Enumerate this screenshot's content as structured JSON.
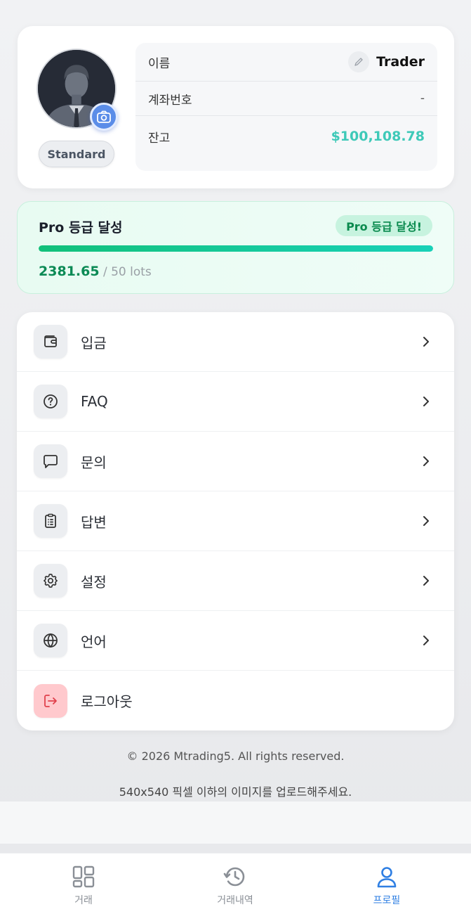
{
  "profile": {
    "tier": "Standard",
    "name_label": "이름",
    "name": "Trader",
    "account_label": "계좌번호",
    "account_number": "-",
    "balance_label": "잔고",
    "balance": "$100,108.78"
  },
  "pro": {
    "title": "Pro 등급 달성",
    "badge": "Pro 등급 달성!",
    "current": "2381.65",
    "target": "/ 50 lots",
    "progress_fraction": 1.0
  },
  "menu": {
    "items": [
      {
        "label": "입금",
        "icon": "wallet-icon"
      },
      {
        "label": "FAQ",
        "icon": "help-circle-icon"
      },
      {
        "label": "문의",
        "icon": "message-icon"
      },
      {
        "label": "답변",
        "icon": "clipboard-icon"
      },
      {
        "label": "설정",
        "icon": "gear-icon"
      },
      {
        "label": "언어",
        "icon": "globe-icon"
      },
      {
        "label": "로그아웃",
        "icon": "logout-icon"
      }
    ]
  },
  "footer": {
    "copyright": "© 2026 Mtrading5. All rights reserved.",
    "upload_hint": "540x540 픽셀 이하의 이미지를 업로드해주세요."
  },
  "nav": {
    "items": [
      {
        "label": "거래",
        "icon": "grid-icon"
      },
      {
        "label": "거래내역",
        "icon": "history-icon"
      },
      {
        "label": "프로필",
        "icon": "user-icon",
        "active": true
      }
    ]
  },
  "colors": {
    "accent": "#2f7fe3",
    "balance": "#3ec9b8",
    "progress": "#12c07a",
    "logout_bg": "#ffc9cd"
  }
}
